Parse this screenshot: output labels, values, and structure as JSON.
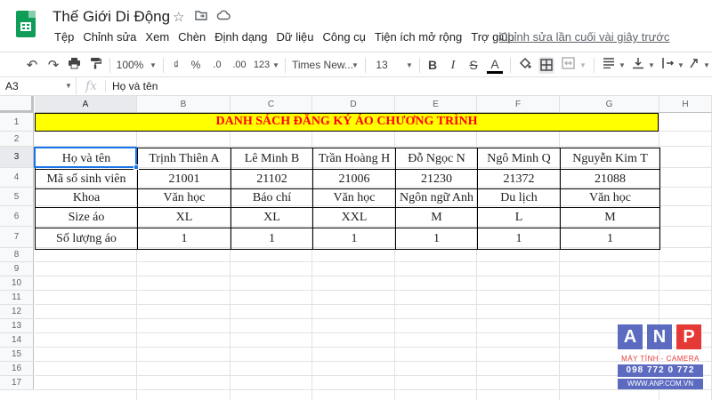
{
  "app": {
    "title": "Thế Giới Di Động",
    "title_icons": [
      "star-icon",
      "move-to-folder-icon",
      "cloud-status-icon"
    ]
  },
  "menu": {
    "items": [
      "Tệp",
      "Chỉnh sửa",
      "Xem",
      "Chèn",
      "Định dạng",
      "Dữ liệu",
      "Công cụ",
      "Tiện ích mở rộng",
      "Trợ giúp"
    ],
    "last_edit": "Chỉnh sửa lần cuối vài giây trước"
  },
  "toolbar": {
    "zoom": "100%",
    "currency": "₫",
    "percent": "%",
    "decimal_decrease": ".0",
    "decimal_increase": ".00",
    "more_formats": "123",
    "font": "Times New...",
    "font_size": "13",
    "bold": "B",
    "italic": "I",
    "strikethrough": "S",
    "text_color": "A"
  },
  "formula_bar": {
    "cell_ref": "A3",
    "fx": "fx",
    "value": "Họ và tên"
  },
  "columns": [
    "A",
    "B",
    "C",
    "D",
    "E",
    "F",
    "G",
    "H"
  ],
  "rows": [
    "1",
    "2",
    "3",
    "4",
    "5",
    "6",
    "7",
    "8",
    "9",
    "10",
    "11",
    "12",
    "13",
    "14",
    "15",
    "16",
    "17"
  ],
  "sheet": {
    "title_text": "DANH SÁCH ĐĂNG KÝ ÁO CHƯƠNG TRÌNH",
    "title_bg": "#ffff00",
    "title_color": "#ff0000",
    "table": [
      [
        "Họ và tên",
        "Trịnh Thiên A",
        "Lê Minh B",
        "Trần Hoàng H",
        "Đỗ Ngọc N",
        "Ngô Minh Q",
        "Nguyễn Kim T"
      ],
      [
        "Mã số sinh viên",
        "21001",
        "21102",
        "21006",
        "21230",
        "21372",
        "21088"
      ],
      [
        "Khoa",
        "Văn học",
        "Báo chí",
        "Văn học",
        "Ngôn ngữ Anh",
        "Du lịch",
        "Văn học"
      ],
      [
        "Size áo",
        "XL",
        "XL",
        "XXL",
        "M",
        "L",
        "M"
      ],
      [
        "Số lượng áo",
        "1",
        "1",
        "1",
        "1",
        "1",
        "1"
      ]
    ]
  },
  "watermark": {
    "letters": [
      "A",
      "N",
      "P"
    ],
    "tagline": "MÁY TÍNH - CAMERA",
    "phone": "098 772 0 772",
    "url": "WWW.ANP.COM.VN"
  },
  "colors": {
    "brand_green": "#0f9d58",
    "selection_blue": "#1a73e8",
    "wm_blue": "#5c6bc0",
    "wm_red": "#e53935"
  }
}
